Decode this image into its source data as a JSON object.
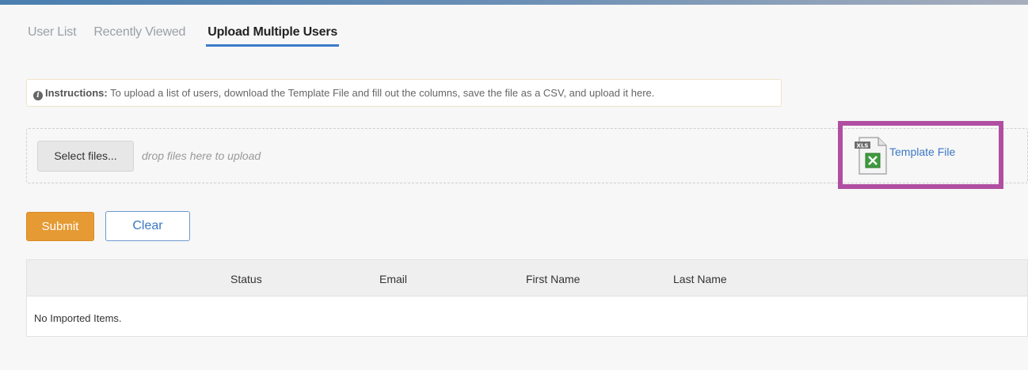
{
  "tabs": [
    {
      "label": "User List"
    },
    {
      "label": "Recently Viewed"
    },
    {
      "label": "Upload Multiple Users"
    }
  ],
  "instructions": {
    "icon": "info-icon",
    "label": "Instructions:",
    "text": " To upload a list of users, download the Template File and fill out the columns, save the file as a CSV, and upload it here."
  },
  "upload": {
    "select_label": "Select files...",
    "drop_hint": "drop files here to upload"
  },
  "template": {
    "icon": "xls-file-icon",
    "badge": "XLS",
    "link_label": "Template File",
    "highlight_color": "#b04fa1"
  },
  "actions": {
    "submit_label": "Submit",
    "clear_label": "Clear",
    "submit_color": "#e69a33"
  },
  "grid": {
    "columns": [
      "Status",
      "Email",
      "First Name",
      "Last Name"
    ],
    "empty_message": "No Imported Items."
  }
}
